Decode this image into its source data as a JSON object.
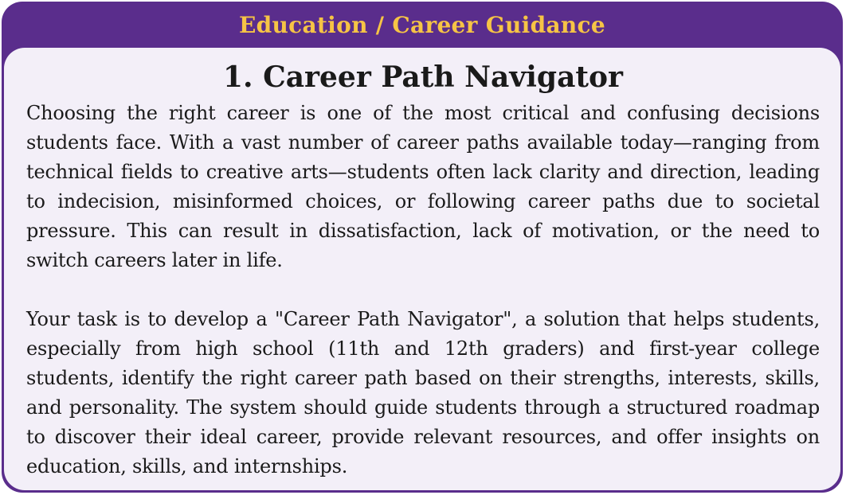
{
  "header": {
    "title": "Education / Career Guidance"
  },
  "problem": {
    "title": "1. Career Path Navigator",
    "paragraphs": [
      "Choosing the right career is one of the most critical and confusing decisions students face. With a vast number of career paths available today—ranging from technical fields to creative arts—students often lack clarity and direction, leading to indecision, misinformed choices, or following career paths due to societal pressure. This can result in dissatisfaction, lack of motivation, or the need to switch careers later in life.",
      "Your task is to develop a \"Career Path Navigator\", a solution that helps students, especially from high school (11th and 12th graders) and first-year college students, identify the right career path based on their strengths, interests, skills, and personality. The system should guide students through a structured roadmap to discover their ideal career, provide relevant resources, and offer insights on education, skills, and internships."
    ]
  },
  "colors": {
    "frame": "#5a2d8c",
    "header_text": "#f6c445",
    "panel_background": "#f3eff8",
    "body_text": "#1a1a1a"
  }
}
